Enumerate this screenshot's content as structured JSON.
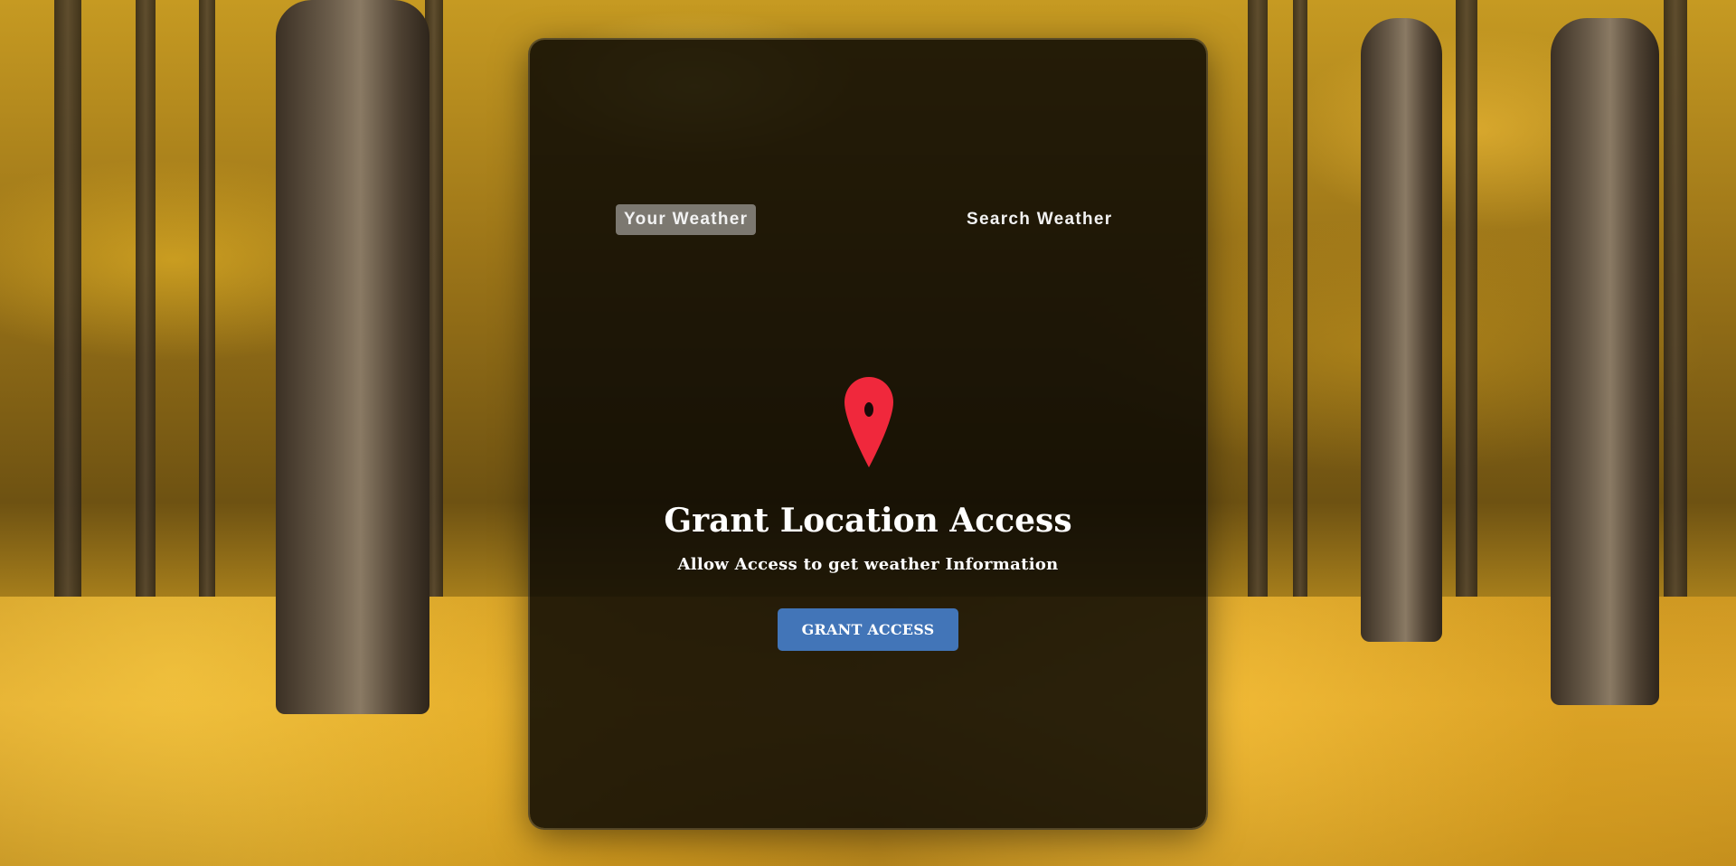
{
  "tabs": {
    "your_weather": "Your Weather",
    "search_weather": "Search Weather"
  },
  "grant": {
    "title": "Grant Location Access",
    "subtitle": "Allow Access to get weather Information",
    "button_label": "GRANT ACCESS",
    "icon": "location-pin-icon"
  },
  "colors": {
    "pin": "#f0283c",
    "button": "#4275b8",
    "active_tab": "#c8c8c8"
  }
}
